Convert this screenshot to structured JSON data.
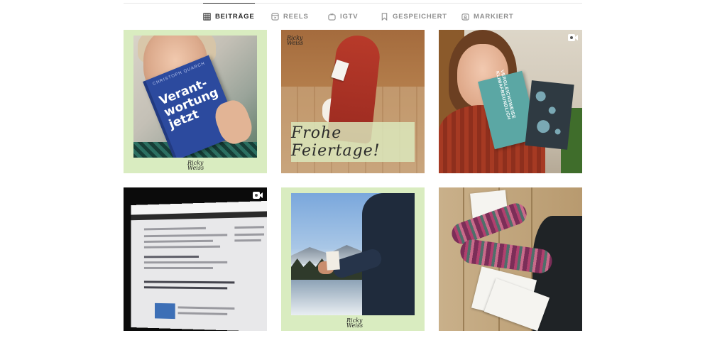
{
  "tabs": [
    {
      "label": "BEITRÄGE",
      "icon": "grid-icon",
      "active": true
    },
    {
      "label": "REELS",
      "icon": "reels-icon",
      "active": false
    },
    {
      "label": "IGTV",
      "icon": "igtv-icon",
      "active": false
    },
    {
      "label": "GESPEICHERT",
      "icon": "bookmark-icon",
      "active": false
    },
    {
      "label": "MARKIERT",
      "icon": "tagged-icon",
      "active": false
    }
  ],
  "posts": [
    {
      "book_title": "Verant-\nwortung\njetzt",
      "book_small": "CHRISTOPH QUARCH",
      "signature": "Ricky\nWeiss"
    },
    {
      "overlay_text": "Frohe Feiertage!",
      "signature": "Ricky\nWeiss"
    },
    {
      "booklet_text": "VERGLEICHSWEISE KLIMAFREUNDLICH",
      "is_video": true
    },
    {
      "is_video": true
    },
    {
      "signature": "Ricky\nWeiss"
    },
    {}
  ]
}
